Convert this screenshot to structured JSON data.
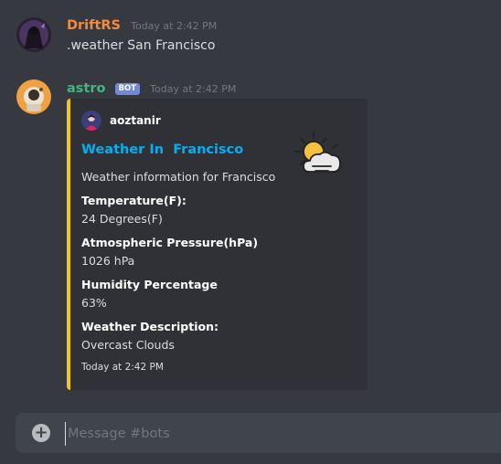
{
  "messages": [
    {
      "username": "DriftRS",
      "username_color": "#f48a3a",
      "timestamp": "Today at 2:42 PM",
      "content": ".weather San Francisco"
    },
    {
      "username": "astro",
      "username_color": "#43b581",
      "bot_tag": "BOT",
      "timestamp": "Today at 2:42 PM",
      "embed": {
        "accent_color": "#f5c518",
        "author": "aoztanir",
        "title": "Weather In  Francisco",
        "description": "Weather information for Francisco",
        "fields": [
          {
            "name": "Temperature(F):",
            "value": "24 Degrees(F)"
          },
          {
            "name": "Atmospheric Pressure(hPa)",
            "value": "1026 hPa"
          },
          {
            "name": "Humidity Percentage",
            "value": "63%"
          },
          {
            "name": "Weather Description:",
            "value": "Overcast Clouds"
          }
        ],
        "footer": "Today at 2:42 PM",
        "thumbnail_icon": "partly-cloudy-weather-icon"
      }
    }
  ],
  "composer": {
    "placeholder": "Message #bots",
    "add_icon": "plus-circle-icon"
  }
}
